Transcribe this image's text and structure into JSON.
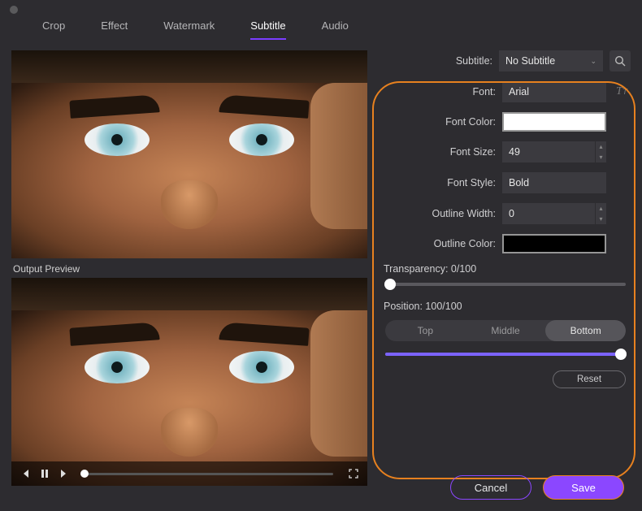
{
  "tabs": {
    "items": [
      "Crop",
      "Effect",
      "Watermark",
      "Subtitle",
      "Audio"
    ],
    "active": "Subtitle"
  },
  "output_preview_label": "Output Preview",
  "form": {
    "subtitle": {
      "label": "Subtitle:",
      "value": "No Subtitle"
    },
    "font": {
      "label": "Font:",
      "value": "Arial"
    },
    "font_color": {
      "label": "Font Color:",
      "swatch": "#ffffff"
    },
    "font_size": {
      "label": "Font Size:",
      "value": "49"
    },
    "font_style": {
      "label": "Font Style:",
      "value": "Bold"
    },
    "outline_width": {
      "label": "Outline Width:",
      "value": "0"
    },
    "outline_color": {
      "label": "Outline Color:",
      "swatch": "#000000"
    },
    "transparency": {
      "label_prefix": "Transparency: ",
      "value": 0,
      "max": 100
    },
    "position": {
      "label_prefix": "Position: ",
      "value": 100,
      "max": 100,
      "options": {
        "top": "Top",
        "middle": "Middle",
        "bottom": "Bottom"
      },
      "selected": "bottom"
    },
    "reset": "Reset"
  },
  "footer": {
    "cancel": "Cancel",
    "save": "Save"
  }
}
